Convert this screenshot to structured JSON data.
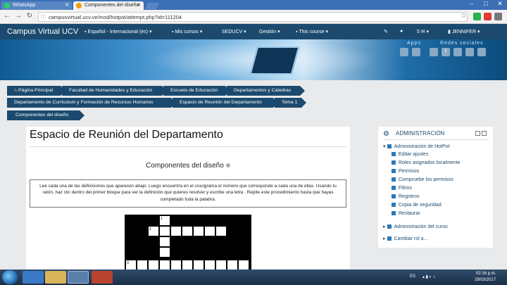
{
  "browser": {
    "tabs": [
      {
        "label": "WhatsApp",
        "icon": "whatsapp-icon"
      },
      {
        "label": "Componentes del diseño",
        "icon": "moodle-icon"
      }
    ],
    "url": "campusvirtual.ucv.ve/mod/hotpot/attempt.php?id=111204",
    "ext_colors": [
      "#2bb24c",
      "#e53935",
      "#3b8e3a"
    ]
  },
  "navbar": {
    "brand": "Campus Virtual UCV",
    "language": "Español - Internacional (es)",
    "mis_cursos": "Mis cursos",
    "seducv": "SEDUCV",
    "gestion": "Gestión",
    "this_course": "This course",
    "count": "5",
    "user": "JENNIFER"
  },
  "banner": {
    "apps_label": "Apps",
    "redes_label": "Redes sociales"
  },
  "breadcrumbs": [
    "Página Principal",
    "Facultad de Humanidades y Educación",
    "Escuela de Educación",
    "Departamentos y Cátedras",
    "Departamento de Curriculum y Formación de Recursos Humanos",
    "Espacio de Reunión del Departamento",
    "Tema 1",
    "Componentes del diseño"
  ],
  "main": {
    "title": "Espacio de Reunión del Departamento",
    "component_title": "Componentes del diseño",
    "instructions": "Lee cada una de las definiciones que aparecen abajo. Luego encuentra en el crucigrama el número que corresponde a cada una de ellas. Usando tu ratón, haz clic dentro del primer bloque para ver la definición que quieres resolver y escribe una letra . Repite este procedimiento hasta que hayas completado toda la palabra.",
    "clue_numbers": [
      "1",
      "2",
      "3"
    ]
  },
  "sidebar": {
    "heading": "ADMINISTRACIÓN",
    "admin_hotpot": "Administración de HotPot",
    "items": [
      "Editar ajustes",
      "Roles asignados localmente",
      "Permisos",
      "Compruebe los permisos",
      "Filtros",
      "Registros",
      "Copia de seguridad",
      "Restaurar"
    ],
    "admin_course": "Administración del curso",
    "switch_role": "Cambiar rol a..."
  },
  "taskbar": {
    "lang": "ES",
    "time": "02:16 p.m.",
    "date": "29/03/2017"
  },
  "colors": {
    "navbar": "#1b4a6e",
    "accent": "#2a79b8"
  }
}
